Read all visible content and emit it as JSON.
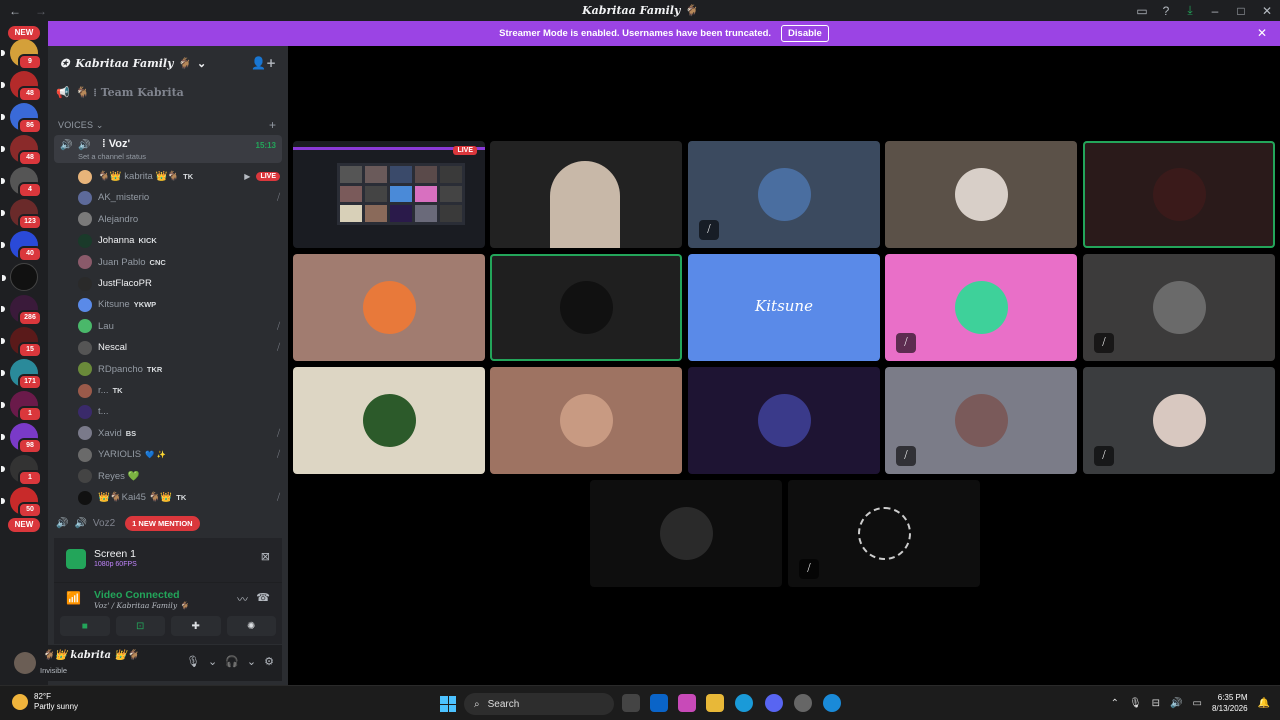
{
  "window": {
    "title": "Kabritaa Family 🐐"
  },
  "banner": {
    "text": "Streamer Mode is enabled. Usernames have been truncated.",
    "button": "Disable"
  },
  "rail": {
    "new_top": "NEW",
    "new_bottom": "NEW",
    "badges": [
      "9",
      "48",
      "86",
      "48",
      "4",
      "123",
      "40",
      "286",
      "15",
      "171",
      "1",
      "98",
      "1",
      "50"
    ]
  },
  "server": {
    "name": "Kabritaa Family 🐐",
    "team_channel": "🐐 ⁞ Team Kabrita"
  },
  "category": "VOICES",
  "voice_channel": {
    "name": "⁞ Voz'",
    "status": "Set a channel status",
    "timer": "15:13"
  },
  "members": [
    {
      "name": "🐐👑 kabrita 👑🐐",
      "tag": "TK",
      "live": "LIVE",
      "color": "#e8b47a"
    },
    {
      "name": "AK_misterio",
      "tag": "",
      "color": "#5d6a9a"
    },
    {
      "name": "Alejandro",
      "tag": "",
      "color": "#7a7a7a"
    },
    {
      "name": "Johanna",
      "tag": "KICK",
      "color": "#1a3a2a"
    },
    {
      "name": "Juan Pablo",
      "tag": "CNC",
      "color": "#8a5a6a"
    },
    {
      "name": "JustFlacoPR",
      "tag": "",
      "color": "#2a2a2a"
    },
    {
      "name": "Kitsune",
      "tag": "YKWP",
      "color": "#5a8ae8"
    },
    {
      "name": "Lau",
      "tag": "",
      "color": "#4ab86a"
    },
    {
      "name": "Nescal",
      "tag": "",
      "color": "#555"
    },
    {
      "name": "RDpancho",
      "tag": "TKR",
      "color": "#6a8a3a"
    },
    {
      "name": "r...",
      "tag": "TK",
      "color": "#9a5a4a"
    },
    {
      "name": "t...",
      "tag": "",
      "color": "#3a2a6a"
    },
    {
      "name": "Xavid",
      "tag": "BS",
      "color": "#7a7a8a"
    },
    {
      "name": "YARIOLIS",
      "tag": "💙 ✨",
      "color": "#6a6a6a"
    },
    {
      "name": "Reyes 💚",
      "tag": "",
      "color": "#444"
    },
    {
      "name": "👑🐐Kai45 🐐👑",
      "tag": "TK",
      "color": "#111"
    }
  ],
  "voz2": {
    "name": "Voz2",
    "mention": "1 NEW MENTION"
  },
  "screen_share": {
    "title": "Screen 1",
    "quality": "1080p 60FPS"
  },
  "rtc": {
    "status": "Video Connected",
    "channel": "Voz' / Kabritaa Family 🐐"
  },
  "user": {
    "name": "🐐👑 kabrita 👑🐐",
    "status": "Invisible"
  },
  "tiles": [
    {
      "bg": "#1a1c22",
      "live": "LIVE"
    },
    {
      "bg": "#222"
    },
    {
      "bg": "#3b4a5f",
      "circ": "#4a6ea0",
      "muted": true
    },
    {
      "bg": "#5b5148",
      "circ": "#d8cfc8"
    },
    {
      "bg": "#2a1a1a",
      "circ": "#3a1a1a",
      "speaking": true
    },
    {
      "bg": "#a17c70",
      "circ": "#e8793a"
    },
    {
      "bg": "#1f1f1f",
      "circ": "#111",
      "speaking": true
    },
    {
      "bg": "#5a8ae8",
      "text": "Kitsune"
    },
    {
      "bg": "#e96fc8",
      "circ": "#3ed19a",
      "muted": true
    },
    {
      "bg": "#3c3b3b",
      "circ": "#6a6a6a",
      "muted": true
    },
    {
      "bg": "#ddd6c4",
      "circ": "#2c5a2a"
    },
    {
      "bg": "#9e7362",
      "circ": "#c89a82"
    },
    {
      "bg": "#1e1433",
      "circ": "#3a3a8a"
    },
    {
      "bg": "#7b7c88",
      "circ": "#7a5a5a",
      "muted": true
    },
    {
      "bg": "#3b3d3f",
      "circ": "#d8c8c0",
      "muted": true
    },
    {
      "bg": "#0e0e0e",
      "circ": "#2a2a2a"
    },
    {
      "bg": "#0e0e0e",
      "circ": "#0e0e0e",
      "muted": true
    }
  ],
  "taskbar": {
    "temp": "82°F",
    "weather": "Partly sunny",
    "search": "Search",
    "time": "6:35 PM",
    "date": "8/13/2026"
  }
}
